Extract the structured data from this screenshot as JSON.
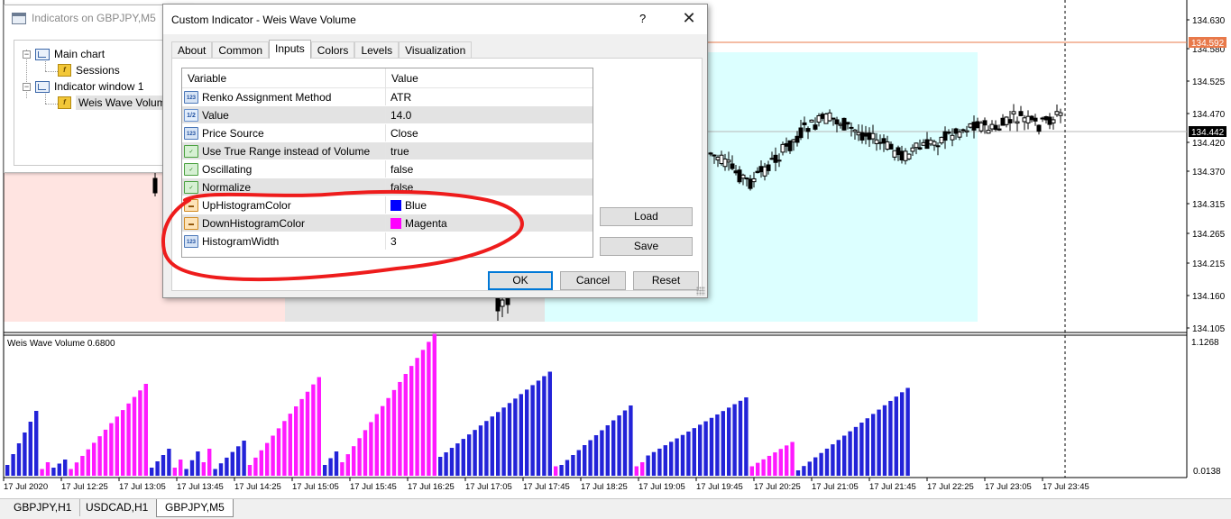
{
  "nav": {
    "title": "Indicators on GBPJPY,M5",
    "tree": [
      {
        "label": "Main chart",
        "kind": "chart"
      },
      {
        "label": "Sessions",
        "kind": "indicator"
      },
      {
        "label": "Indicator window 1",
        "kind": "chart"
      },
      {
        "label": "Weis Wave Volume",
        "kind": "indicator",
        "selected": true
      }
    ]
  },
  "dialog": {
    "title": "Custom Indicator - Weis Wave Volume",
    "help": "?",
    "close": "✕",
    "tabs": [
      "About",
      "Common",
      "Inputs",
      "Colors",
      "Levels",
      "Visualization"
    ],
    "active_tab": "Inputs",
    "grid_headers": {
      "variable": "Variable",
      "value": "Value"
    },
    "params": [
      {
        "name": "Renko Assignment Method",
        "value": "ATR",
        "icon": "int-icon",
        "icon_text": "123"
      },
      {
        "name": "Value",
        "value": "14.0",
        "icon": "double-icon",
        "icon_text": "1/2"
      },
      {
        "name": "Price Source",
        "value": "Close",
        "icon": "int-icon",
        "icon_text": "123"
      },
      {
        "name": "Use True Range instead of Volume",
        "value": "true",
        "icon": "bool-icon",
        "icon_text": "✓"
      },
      {
        "name": "Oscillating",
        "value": "false",
        "icon": "bool-icon",
        "icon_text": "✓"
      },
      {
        "name": "Normalize",
        "value": "false",
        "icon": "bool-icon",
        "icon_text": "✓"
      },
      {
        "name": "UpHistogramColor",
        "value": "Blue",
        "icon": "color-icon",
        "icon_text": "▬",
        "swatch": "#0000ff"
      },
      {
        "name": "DownHistogramColor",
        "value": "Magenta",
        "icon": "color-icon",
        "icon_text": "▬",
        "swatch": "#ff00ff"
      },
      {
        "name": "HistogramWidth",
        "value": "3",
        "icon": "int-icon",
        "icon_text": "123"
      }
    ],
    "buttons": {
      "load": "Load",
      "save": "Save",
      "ok": "OK",
      "cancel": "Cancel",
      "reset": "Reset"
    }
  },
  "chart": {
    "price_labels": [
      "134.630",
      "134.580",
      "134.525",
      "134.470",
      "134.420",
      "134.370",
      "134.315",
      "134.265",
      "134.215",
      "134.160",
      "134.105"
    ],
    "current_price": "134.592",
    "last_price": "134.442",
    "indicator_label": "Weis Wave Volume 0.6800",
    "indicator_max": "1.1268",
    "indicator_min": "0.0138",
    "time_labels": [
      "17 Jul 2020",
      "17 Jul 12:25",
      "17 Jul 13:05",
      "17 Jul 13:45",
      "17 Jul 14:25",
      "17 Jul 15:05",
      "17 Jul 15:45",
      "17 Jul 16:25",
      "17 Jul 17:05",
      "17 Jul 17:45",
      "17 Jul 18:25",
      "17 Jul 19:05",
      "17 Jul 19:45",
      "17 Jul 20:25",
      "17 Jul 21:05",
      "17 Jul 21:45",
      "17 Jul 22:25",
      "17 Jul 23:05",
      "17 Jul 23:45"
    ],
    "colors": {
      "up": "#2323d8",
      "down": "#ff1aff",
      "session_pink": "#ffe4e1",
      "session_gray": "#e4e4e4",
      "session_cyan": "#dcffff",
      "price_line": "#e8794a"
    }
  },
  "tabbar": [
    "GBPJPY,H1",
    "USDCAD,H1",
    "GBPJPY,M5"
  ],
  "tabbar_active": 2
}
